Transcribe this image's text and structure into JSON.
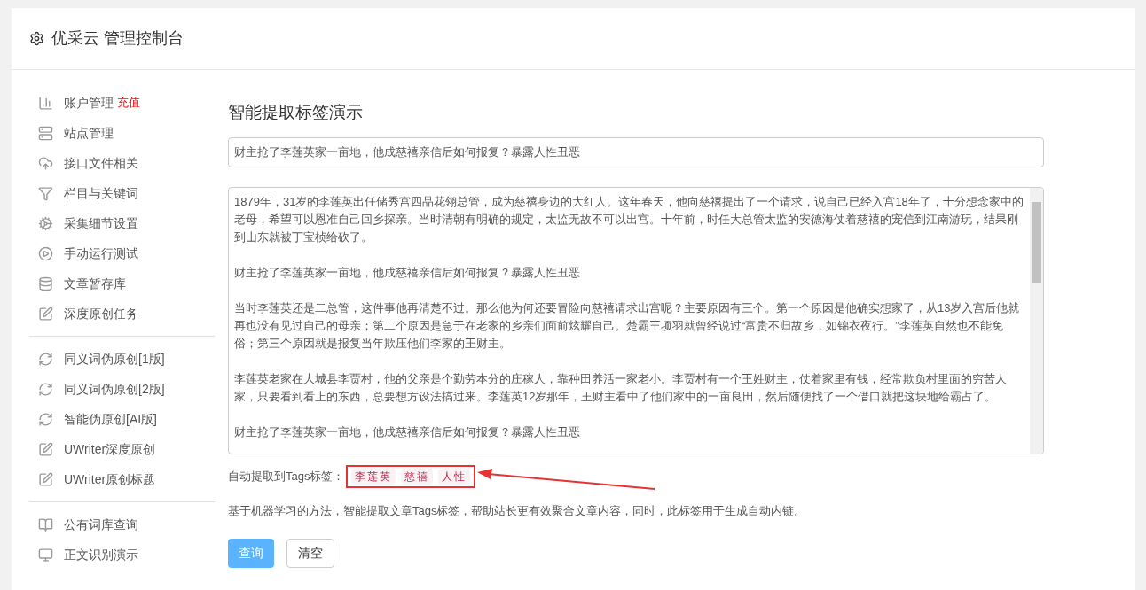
{
  "header": {
    "title": "优采云 管理控制台"
  },
  "sidebar": {
    "groups": [
      {
        "items": [
          {
            "label": "账户管理",
            "badge": "充值"
          },
          {
            "label": "站点管理"
          },
          {
            "label": "接口文件相关"
          },
          {
            "label": "栏目与关键词"
          },
          {
            "label": "采集细节设置"
          },
          {
            "label": "手动运行测试"
          },
          {
            "label": "文章暂存库"
          },
          {
            "label": "深度原创任务"
          }
        ]
      },
      {
        "items": [
          {
            "label": "同义词伪原创[1版]"
          },
          {
            "label": "同义词伪原创[2版]"
          },
          {
            "label": "智能伪原创[AI版]"
          },
          {
            "label": "UWriter深度原创"
          },
          {
            "label": "UWriter原创标题"
          }
        ]
      },
      {
        "items": [
          {
            "label": "公有词库查询"
          },
          {
            "label": "正文识别演示"
          }
        ]
      }
    ]
  },
  "page": {
    "title": "智能提取标签演示"
  },
  "title_field": {
    "value": "财主抢了李莲英家一亩地，他成慈禧亲信后如何报复？暴露人性丑恶"
  },
  "article": {
    "paragraphs": [
      "1879年，31岁的李莲英出任储秀宫四品花翎总管，成为慈禧身边的大红人。这年春天，他向慈禧提出了一个请求，说自己已经入宫18年了，十分想念家中的老母，希望可以恩准自己回乡探亲。当时清朝有明确的规定，太监无故不可以出宫。十年前，时任大总管太监的安德海仗着慈禧的宠信到江南游玩，结果刚到山东就被丁宝桢给砍了。",
      "财主抢了李莲英家一亩地，他成慈禧亲信后如何报复？暴露人性丑恶",
      "当时李莲英还是二总管，这件事他再清楚不过。那么他为何还要冒险向慈禧请求出宫呢？主要原因有三个。第一个原因是他确实想家了，从13岁入宫后他就再也没有见过自己的母亲；第二个原因是急于在老家的乡亲们面前炫耀自己。楚霸王项羽就曾经说过“富贵不归故乡，如锦衣夜行。”李莲英自然也不能免俗；第三个原因就是报复当年欺压他们李家的王财主。",
      "李莲英老家在大城县李贾村，他的父亲是个勤劳本分的庄稼人，靠种田养活一家老小。李贾村有一个王姓财主，仗着家里有钱，经常欺负村里面的穷苦人家，只要看到看上的东西，总要想方设法搞过来。李莲英12岁那年，王财主看中了他们家中的一亩良田，然后随便找了一个借口就把这块地给霸占了。",
      "财主抢了李莲英家一亩地，他成慈禧亲信后如何报复？暴露人性丑恶"
    ]
  },
  "tags": {
    "label": "自动提取到Tags标签：",
    "items": [
      "李莲英",
      "慈禧",
      "人性"
    ]
  },
  "hint": "基于机器学习的方法，智能提取文章Tags标签，帮助站长更有效聚合文章内容，同时，此标签用于生成自动内链。",
  "buttons": [
    {
      "label": "查询",
      "kind": "primary"
    },
    {
      "label": "清空",
      "kind": "default"
    }
  ]
}
